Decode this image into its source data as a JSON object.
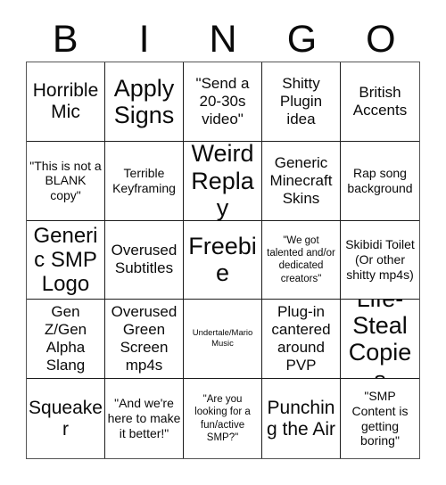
{
  "card": {
    "title": "BINGO",
    "header_letters": [
      "B",
      "I",
      "N",
      "G",
      "O"
    ],
    "columns": 5,
    "rows": 5,
    "free_space_label": "Freebie",
    "free_space_index": 12,
    "colors": {
      "background": "#ffffff",
      "text": "#0a0a0a",
      "grid_line": "#1c1c1c",
      "outer_border": "#555555"
    },
    "cells": [
      {
        "text": "Horrible Mic",
        "size": "lg"
      },
      {
        "text": "Apply Signs",
        "size": "xxl"
      },
      {
        "text": "\"Send a 20-30s video\"",
        "size": "md"
      },
      {
        "text": "Shitty Plugin idea",
        "size": "md"
      },
      {
        "text": "British Accents",
        "size": "md"
      },
      {
        "text": "\"This is not a BLANK copy\"",
        "size": "sm"
      },
      {
        "text": "Terrible Keyframing",
        "size": "sm"
      },
      {
        "text": "Weird Replay",
        "size": "xxl"
      },
      {
        "text": "Generic Minecraft Skins",
        "size": "md"
      },
      {
        "text": "Rap song background",
        "size": "sm"
      },
      {
        "text": "Generic SMP Logo",
        "size": "xl"
      },
      {
        "text": "Overused Subtitles",
        "size": "md"
      },
      {
        "text": "Freebie",
        "size": "xxl"
      },
      {
        "text": "\"We got talented and/or dedicated creators\"",
        "size": "xs"
      },
      {
        "text": "Skibidi Toilet (Or other shitty mp4s)",
        "size": "sm"
      },
      {
        "text": "Gen Z/Gen Alpha Slang",
        "size": "md"
      },
      {
        "text": "Overused Green Screen mp4s",
        "size": "md"
      },
      {
        "text": "Undertale/Mario Music",
        "size": "xxs"
      },
      {
        "text": "Plug-in cantered around PVP",
        "size": "md"
      },
      {
        "text": "Life-Steal Copies",
        "size": "xxl"
      },
      {
        "text": "Squeaker",
        "size": "lg"
      },
      {
        "text": "\"And we're here to make it better!\"",
        "size": "sm"
      },
      {
        "text": "\"Are you looking for a fun/active SMP?\"",
        "size": "xs"
      },
      {
        "text": "Punching the Air",
        "size": "lg"
      },
      {
        "text": "\"SMP Content is getting boring\"",
        "size": "sm"
      }
    ]
  }
}
